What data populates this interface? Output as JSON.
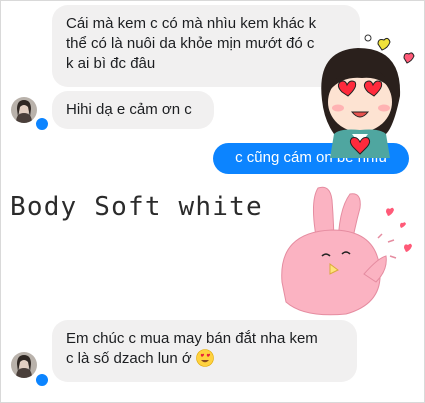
{
  "messages": [
    {
      "direction": "incoming",
      "lines": [
        "Cái mà kem c có mà nhìu kem khác k",
        "thể có là nuôi da khỏe mịn mướt đó c",
        "k ai bì đc đâu"
      ]
    },
    {
      "direction": "incoming",
      "text": "Hihi dạ e cảm ơn c"
    },
    {
      "direction": "outgoing",
      "text": "c cũng cám on bé nhìu"
    },
    {
      "direction": "incoming",
      "lines": [
        "Em chúc c mua may bán đắt nha kem",
        "c là số dzach lun ớ"
      ],
      "emoji": "heart-eyes-emoji"
    }
  ],
  "caption": "Body Soft white",
  "colors": {
    "outgoing_bubble": "#0c84ff",
    "incoming_bubble": "#f1f0f0",
    "messenger_badge": "#0c84ff"
  }
}
